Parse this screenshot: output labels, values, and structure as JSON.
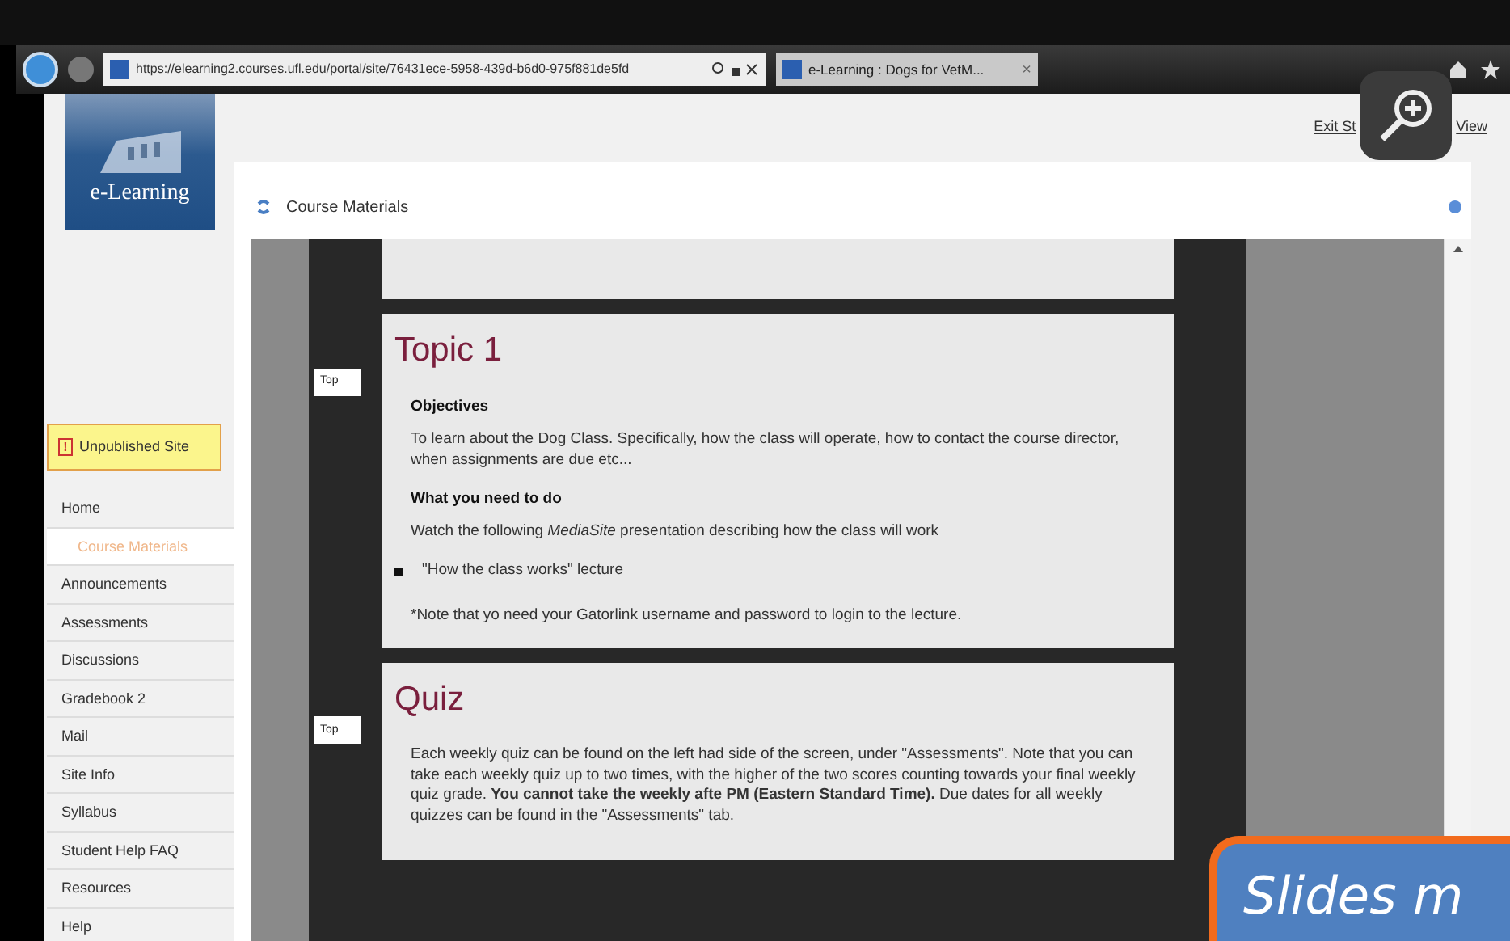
{
  "browser": {
    "url": "https://elearning2.courses.ufl.edu/portal/site/76431ece-5958-439d-b6d0-975f881de5fd",
    "tab": {
      "title": "e-Learning : Dogs for VetM...",
      "close": "×"
    }
  },
  "logo": {
    "text": "e-Learning"
  },
  "exit_link": {
    "start": "Exit St",
    "end": "View"
  },
  "notice": {
    "icon": "!",
    "text": "Unpublished Site"
  },
  "sidebar": {
    "items": [
      {
        "label": "Home",
        "selected": false
      },
      {
        "label": "Course Materials",
        "selected": true
      },
      {
        "label": "Announcements",
        "selected": false
      },
      {
        "label": "Assessments",
        "selected": false
      },
      {
        "label": "Discussions",
        "selected": false
      },
      {
        "label": "Gradebook 2",
        "selected": false
      },
      {
        "label": "Mail",
        "selected": false
      },
      {
        "label": "Site Info",
        "selected": false
      },
      {
        "label": "Syllabus",
        "selected": false
      },
      {
        "label": "Student Help FAQ",
        "selected": false
      },
      {
        "label": "Resources",
        "selected": false
      },
      {
        "label": "Help",
        "selected": false
      }
    ]
  },
  "tool": {
    "title": "Course Materials"
  },
  "sections": [
    {
      "top_button": "Top",
      "heading": "Topic 1",
      "blocks": [
        {
          "kind": "subheading",
          "text": "Objectives"
        },
        {
          "kind": "paragraph",
          "text": "To learn about the Dog Class.  Specifically, how the class will operate, how to contact the course director, when assignments are due etc..."
        },
        {
          "kind": "subheading",
          "text": "What you need to do"
        },
        {
          "kind": "paragraph",
          "text": "Watch the following *MediaSite* presentation describing how the class will work"
        },
        {
          "kind": "bullet",
          "text": "\"How the class works\" lecture"
        },
        {
          "kind": "note",
          "text": "*Note that yo need your Gatorlink username and password to login to the lecture."
        }
      ]
    },
    {
      "top_button": "Top",
      "heading": "Quiz",
      "blocks": [
        {
          "kind": "paragraph",
          "text": "Each weekly quiz can be found on the left had side of the screen, under \"Assessments\". Note that you can take each weekly quiz up to two times, with the higher of the two scores counting towards your final weekly quiz grade.  **You cannot take the weekly afte PM (Eastern Standard Time).**  Due dates for all weekly quizzes can be found in the \"Assessments\" tab."
        }
      ]
    }
  ],
  "overlay": {
    "text": "Slides m"
  }
}
